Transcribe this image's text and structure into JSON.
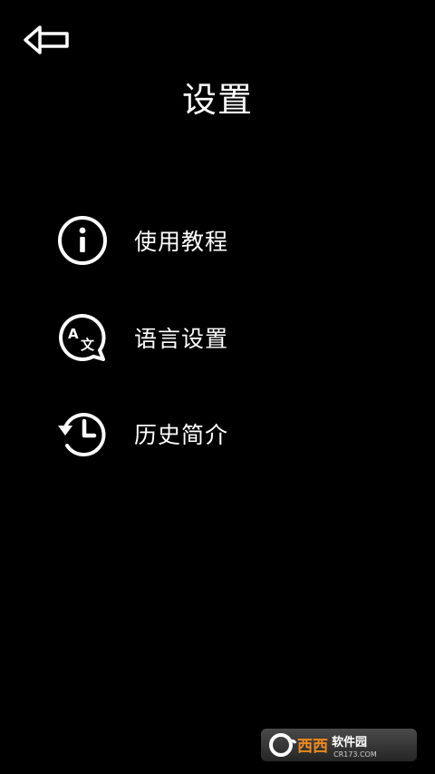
{
  "header": {
    "back_icon": "back-arrow-icon",
    "title": "设置"
  },
  "menu": {
    "items": [
      {
        "label": "使用教程",
        "icon": "info-icon"
      },
      {
        "label": "语言设置",
        "icon": "translate-icon"
      },
      {
        "label": "历史简介",
        "icon": "history-icon"
      }
    ]
  },
  "watermark": {
    "text_main": "西西软件园",
    "text_domain": "CR173.COM"
  },
  "colors": {
    "background": "#000000",
    "foreground": "#ffffff",
    "watermark_accent": "#f08a1c"
  }
}
